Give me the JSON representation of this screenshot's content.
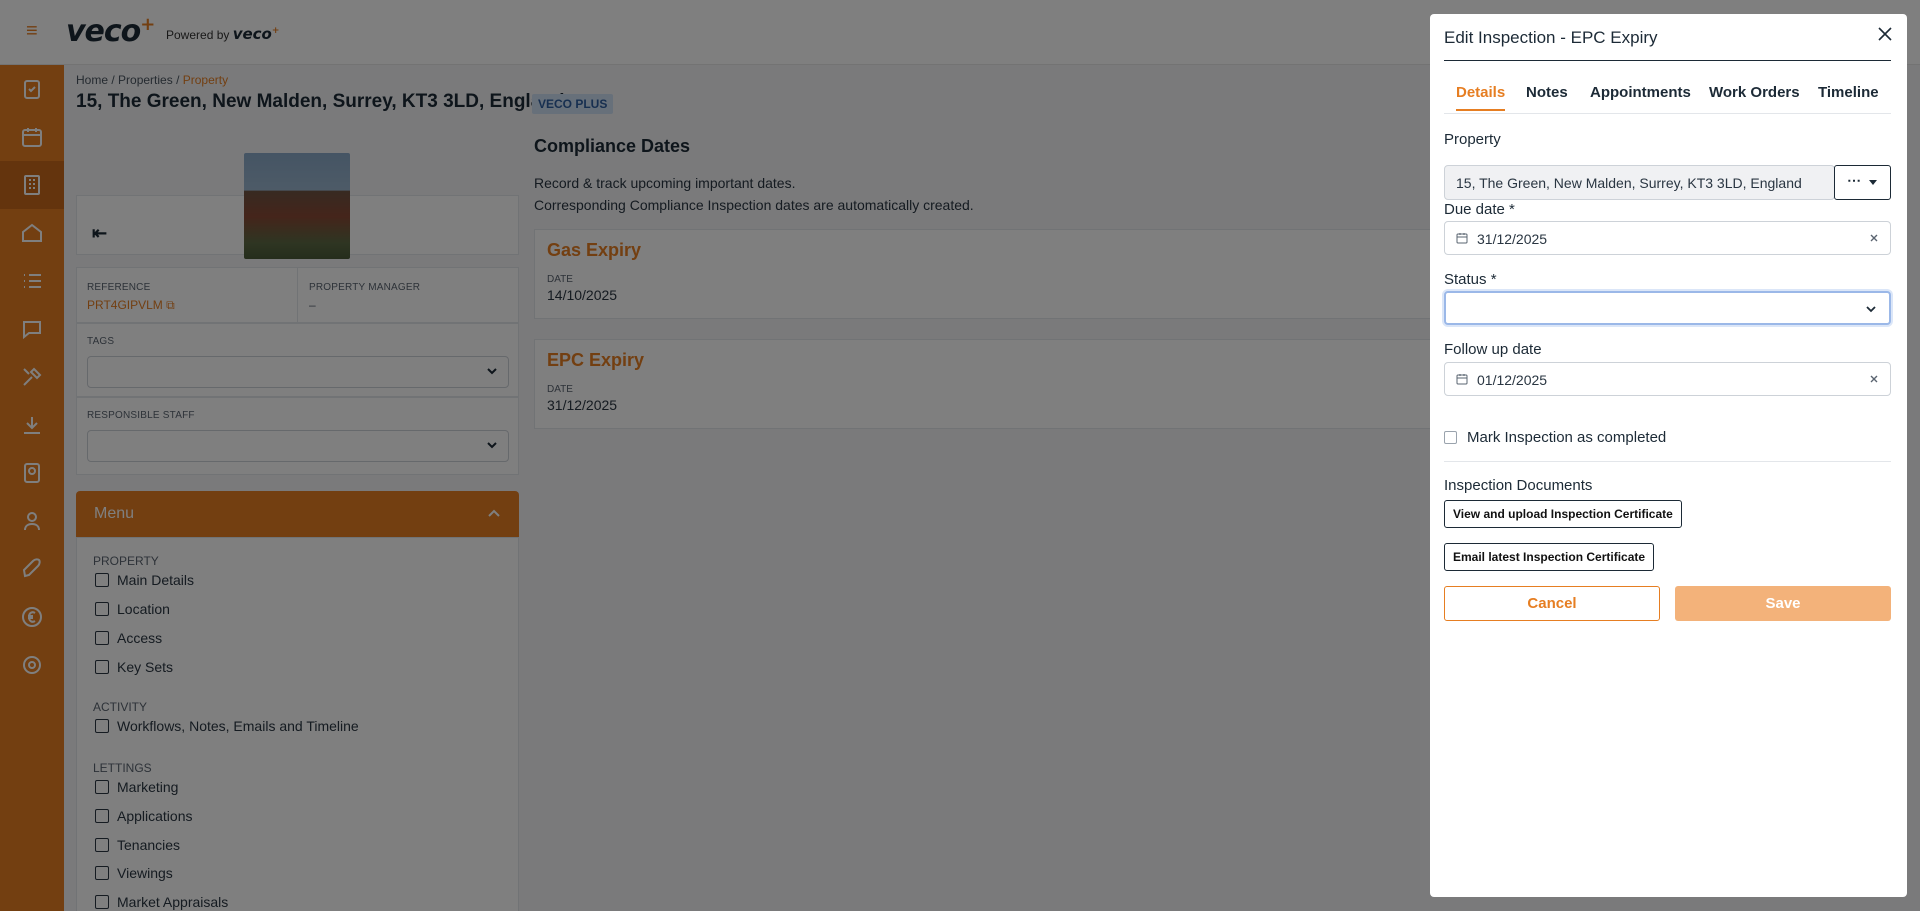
{
  "app": {
    "logo": "veco",
    "powered_by": "Powered by",
    "powered_by_brand": "veco",
    "accent": "#e67e22"
  },
  "breadcrumb": [
    "Home",
    "Properties",
    "Property"
  ],
  "property": {
    "address": "15, The Green, New Malden, Surrey, KT3 3LD, England",
    "badge": "VECO PLUS",
    "reference_label": "REFERENCE",
    "reference_value": "PRT4GIPVLM",
    "manager_label": "PROPERTY MANAGER",
    "manager_value": "–",
    "tags_label": "TAGS",
    "staff_label": "RESPONSIBLE STAFF"
  },
  "menu": {
    "title": "Menu",
    "sections": [
      {
        "title": "PROPERTY",
        "items": [
          "Main Details",
          "Location",
          "Access",
          "Key Sets"
        ]
      },
      {
        "title": "ACTIVITY",
        "items": [
          "Workflows, Notes, Emails and Timeline"
        ]
      },
      {
        "title": "LETTINGS",
        "items": [
          "Marketing",
          "Applications",
          "Tenancies",
          "Viewings",
          "Market Appraisals"
        ]
      }
    ]
  },
  "compliance": {
    "title": "Compliance Dates",
    "line1": "Record & track upcoming important dates.",
    "line2": "Corresponding Compliance Inspection dates are automatically created.",
    "cards": [
      {
        "title": "Gas Expiry",
        "label": "DATE",
        "value": "14/10/2025"
      },
      {
        "title": "EPC Expiry",
        "label": "DATE",
        "value": "31/12/2025"
      }
    ]
  },
  "modal": {
    "title": "Edit Inspection - EPC Expiry",
    "tabs": [
      "Details",
      "Notes",
      "Appointments",
      "Work Orders",
      "Timeline"
    ],
    "active_tab": "Details",
    "property_label": "Property",
    "property_value": "15, The Green, New Malden, Surrey, KT3 3LD, England",
    "due_label": "Due date *",
    "due_value": "31/12/2025",
    "status_label": "Status *",
    "status_value": "",
    "followup_label": "Follow up date",
    "followup_value": "01/12/2025",
    "complete_label": "Mark Inspection as completed",
    "docs_label": "Inspection Documents",
    "upload_btn": "View and upload Inspection Certificate",
    "email_btn": "Email latest Inspection Certificate",
    "cancel": "Cancel",
    "save": "Save"
  }
}
